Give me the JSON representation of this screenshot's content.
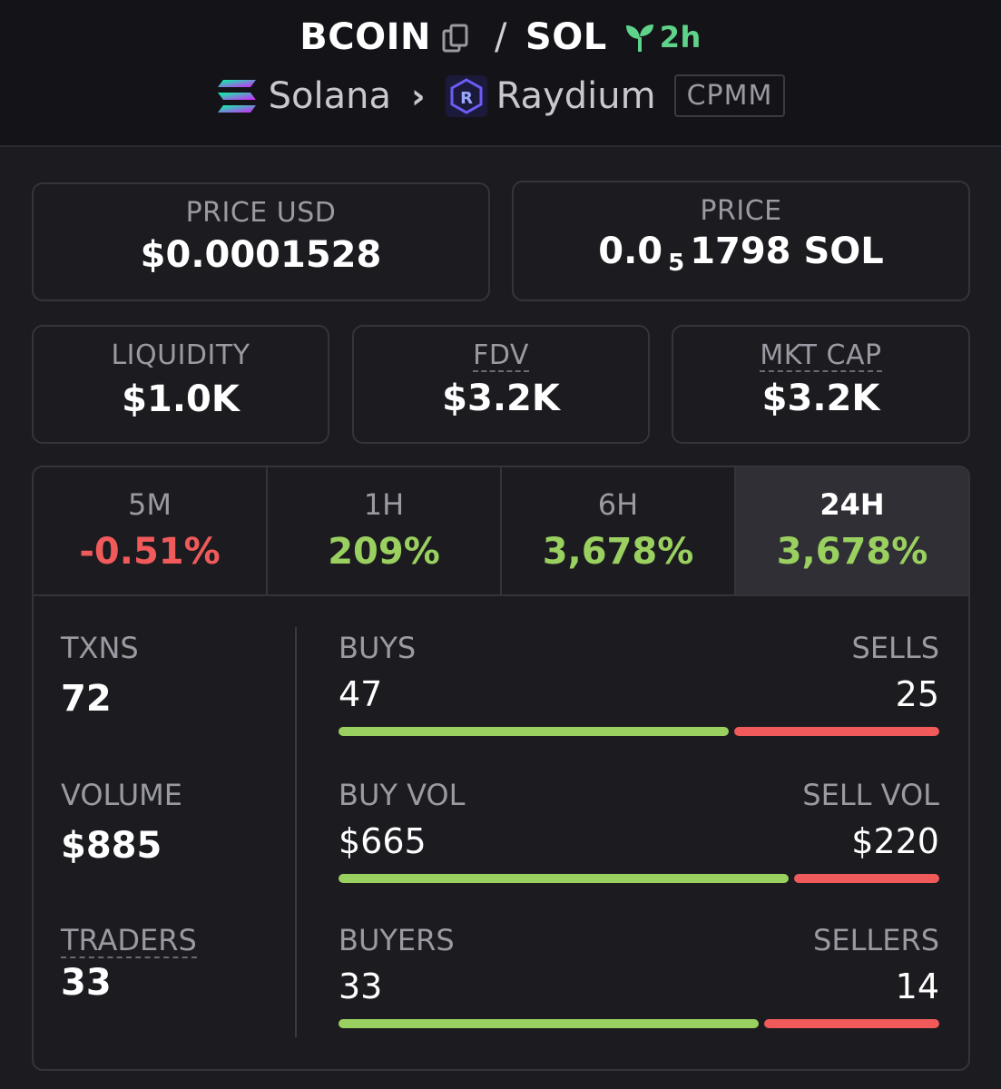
{
  "header": {
    "base_token": "BCOIN",
    "separator": "/",
    "quote_token": "SOL",
    "age": "2h",
    "chain": "Solana",
    "dex": "Raydium",
    "pool_type": "CPMM",
    "icons": [
      "copy-icon",
      "sprout-icon",
      "solana-icon",
      "chevron-right-icon",
      "raydium-icon"
    ]
  },
  "price": {
    "usd_label": "PRICE USD",
    "usd_value": "$0.0001528",
    "native_label": "PRICE",
    "native_prefix": "0.0",
    "native_zero_count": "5",
    "native_suffix": "1798 SOL"
  },
  "metrics": {
    "liquidity_label": "LIQUIDITY",
    "liquidity_value": "$1.0K",
    "fdv_label": "FDV",
    "fdv_value": "$3.2K",
    "mktcap_label": "MKT CAP",
    "mktcap_value": "$3.2K"
  },
  "timeframes": [
    {
      "label": "5M",
      "change": "-0.51%",
      "direction": "negative"
    },
    {
      "label": "1H",
      "change": "209%",
      "direction": "positive"
    },
    {
      "label": "6H",
      "change": "3,678%",
      "direction": "positive"
    },
    {
      "label": "24H",
      "change": "3,678%",
      "direction": "positive",
      "active": true
    }
  ],
  "stats": {
    "txns_label": "TXNS",
    "txns_value": "72",
    "volume_label": "VOLUME",
    "volume_value": "$885",
    "traders_label": "TRADERS",
    "traders_value": "33",
    "buys_label": "BUYS",
    "buys_value": "47",
    "sells_label": "SELLS",
    "sells_value": "25",
    "buy_vol_label": "BUY VOL",
    "buy_vol_value": "$665",
    "sell_vol_label": "SELL VOL",
    "sell_vol_value": "$220",
    "buyers_label": "BUYERS",
    "buyers_value": "33",
    "sellers_label": "SELLERS",
    "sellers_value": "14"
  },
  "colors": {
    "positive": "#9ad05f",
    "negative": "#f05a5a",
    "age_green": "#5fd38a"
  }
}
